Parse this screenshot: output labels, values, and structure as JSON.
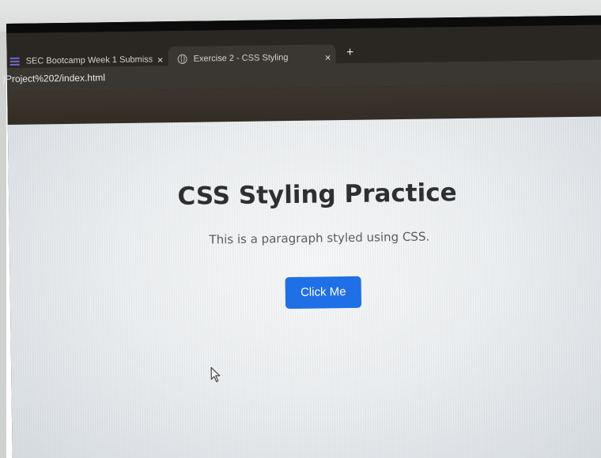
{
  "browser": {
    "tabs": [
      {
        "title": "SEC Bootcamp Week 1 Submiss",
        "icon": "form-icon",
        "close": "×",
        "active": false
      },
      {
        "title": "Exercise 2 - CSS Styling",
        "icon": "globe-icon",
        "close": "×",
        "active": true
      }
    ],
    "new_tab": "+",
    "address_text": ")Project%202/index.html"
  },
  "page": {
    "heading": "CSS Styling Practice",
    "paragraph": "This is a paragraph styled using CSS.",
    "button_label": "Click Me"
  },
  "colors": {
    "button_background": "#1f6fe6",
    "heading_text": "#2e2f31",
    "paragraph_text": "#5a5c5f",
    "tab_bar": "#2a2622",
    "active_tab": "#3a3631"
  }
}
